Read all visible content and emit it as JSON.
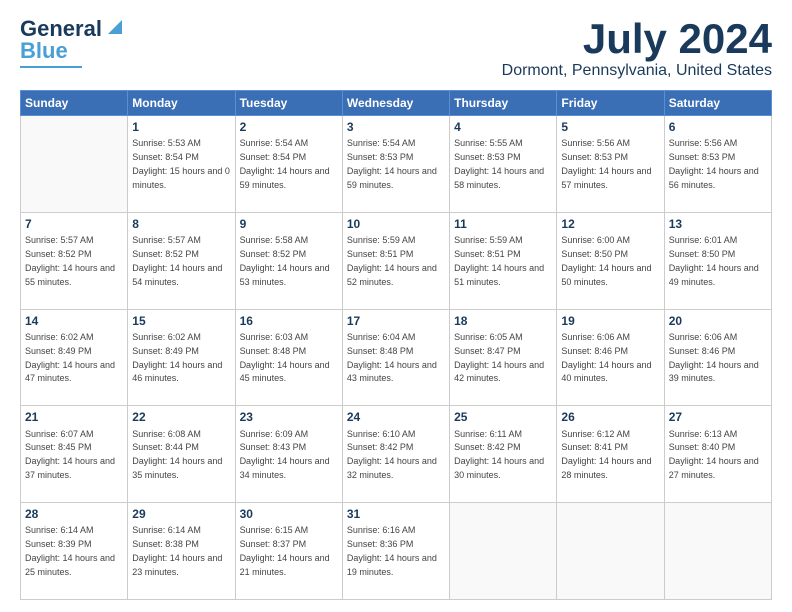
{
  "header": {
    "logo_line1": "General",
    "logo_line2": "Blue",
    "month": "July 2024",
    "location": "Dormont, Pennsylvania, United States"
  },
  "days_of_week": [
    "Sunday",
    "Monday",
    "Tuesday",
    "Wednesday",
    "Thursday",
    "Friday",
    "Saturday"
  ],
  "weeks": [
    [
      {
        "day": "",
        "sunrise": "",
        "sunset": "",
        "daylight": ""
      },
      {
        "day": "1",
        "sunrise": "Sunrise: 5:53 AM",
        "sunset": "Sunset: 8:54 PM",
        "daylight": "Daylight: 15 hours and 0 minutes."
      },
      {
        "day": "2",
        "sunrise": "Sunrise: 5:54 AM",
        "sunset": "Sunset: 8:54 PM",
        "daylight": "Daylight: 14 hours and 59 minutes."
      },
      {
        "day": "3",
        "sunrise": "Sunrise: 5:54 AM",
        "sunset": "Sunset: 8:53 PM",
        "daylight": "Daylight: 14 hours and 59 minutes."
      },
      {
        "day": "4",
        "sunrise": "Sunrise: 5:55 AM",
        "sunset": "Sunset: 8:53 PM",
        "daylight": "Daylight: 14 hours and 58 minutes."
      },
      {
        "day": "5",
        "sunrise": "Sunrise: 5:56 AM",
        "sunset": "Sunset: 8:53 PM",
        "daylight": "Daylight: 14 hours and 57 minutes."
      },
      {
        "day": "6",
        "sunrise": "Sunrise: 5:56 AM",
        "sunset": "Sunset: 8:53 PM",
        "daylight": "Daylight: 14 hours and 56 minutes."
      }
    ],
    [
      {
        "day": "7",
        "sunrise": "Sunrise: 5:57 AM",
        "sunset": "Sunset: 8:52 PM",
        "daylight": "Daylight: 14 hours and 55 minutes."
      },
      {
        "day": "8",
        "sunrise": "Sunrise: 5:57 AM",
        "sunset": "Sunset: 8:52 PM",
        "daylight": "Daylight: 14 hours and 54 minutes."
      },
      {
        "day": "9",
        "sunrise": "Sunrise: 5:58 AM",
        "sunset": "Sunset: 8:52 PM",
        "daylight": "Daylight: 14 hours and 53 minutes."
      },
      {
        "day": "10",
        "sunrise": "Sunrise: 5:59 AM",
        "sunset": "Sunset: 8:51 PM",
        "daylight": "Daylight: 14 hours and 52 minutes."
      },
      {
        "day": "11",
        "sunrise": "Sunrise: 5:59 AM",
        "sunset": "Sunset: 8:51 PM",
        "daylight": "Daylight: 14 hours and 51 minutes."
      },
      {
        "day": "12",
        "sunrise": "Sunrise: 6:00 AM",
        "sunset": "Sunset: 8:50 PM",
        "daylight": "Daylight: 14 hours and 50 minutes."
      },
      {
        "day": "13",
        "sunrise": "Sunrise: 6:01 AM",
        "sunset": "Sunset: 8:50 PM",
        "daylight": "Daylight: 14 hours and 49 minutes."
      }
    ],
    [
      {
        "day": "14",
        "sunrise": "Sunrise: 6:02 AM",
        "sunset": "Sunset: 8:49 PM",
        "daylight": "Daylight: 14 hours and 47 minutes."
      },
      {
        "day": "15",
        "sunrise": "Sunrise: 6:02 AM",
        "sunset": "Sunset: 8:49 PM",
        "daylight": "Daylight: 14 hours and 46 minutes."
      },
      {
        "day": "16",
        "sunrise": "Sunrise: 6:03 AM",
        "sunset": "Sunset: 8:48 PM",
        "daylight": "Daylight: 14 hours and 45 minutes."
      },
      {
        "day": "17",
        "sunrise": "Sunrise: 6:04 AM",
        "sunset": "Sunset: 8:48 PM",
        "daylight": "Daylight: 14 hours and 43 minutes."
      },
      {
        "day": "18",
        "sunrise": "Sunrise: 6:05 AM",
        "sunset": "Sunset: 8:47 PM",
        "daylight": "Daylight: 14 hours and 42 minutes."
      },
      {
        "day": "19",
        "sunrise": "Sunrise: 6:06 AM",
        "sunset": "Sunset: 8:46 PM",
        "daylight": "Daylight: 14 hours and 40 minutes."
      },
      {
        "day": "20",
        "sunrise": "Sunrise: 6:06 AM",
        "sunset": "Sunset: 8:46 PM",
        "daylight": "Daylight: 14 hours and 39 minutes."
      }
    ],
    [
      {
        "day": "21",
        "sunrise": "Sunrise: 6:07 AM",
        "sunset": "Sunset: 8:45 PM",
        "daylight": "Daylight: 14 hours and 37 minutes."
      },
      {
        "day": "22",
        "sunrise": "Sunrise: 6:08 AM",
        "sunset": "Sunset: 8:44 PM",
        "daylight": "Daylight: 14 hours and 35 minutes."
      },
      {
        "day": "23",
        "sunrise": "Sunrise: 6:09 AM",
        "sunset": "Sunset: 8:43 PM",
        "daylight": "Daylight: 14 hours and 34 minutes."
      },
      {
        "day": "24",
        "sunrise": "Sunrise: 6:10 AM",
        "sunset": "Sunset: 8:42 PM",
        "daylight": "Daylight: 14 hours and 32 minutes."
      },
      {
        "day": "25",
        "sunrise": "Sunrise: 6:11 AM",
        "sunset": "Sunset: 8:42 PM",
        "daylight": "Daylight: 14 hours and 30 minutes."
      },
      {
        "day": "26",
        "sunrise": "Sunrise: 6:12 AM",
        "sunset": "Sunset: 8:41 PM",
        "daylight": "Daylight: 14 hours and 28 minutes."
      },
      {
        "day": "27",
        "sunrise": "Sunrise: 6:13 AM",
        "sunset": "Sunset: 8:40 PM",
        "daylight": "Daylight: 14 hours and 27 minutes."
      }
    ],
    [
      {
        "day": "28",
        "sunrise": "Sunrise: 6:14 AM",
        "sunset": "Sunset: 8:39 PM",
        "daylight": "Daylight: 14 hours and 25 minutes."
      },
      {
        "day": "29",
        "sunrise": "Sunrise: 6:14 AM",
        "sunset": "Sunset: 8:38 PM",
        "daylight": "Daylight: 14 hours and 23 minutes."
      },
      {
        "day": "30",
        "sunrise": "Sunrise: 6:15 AM",
        "sunset": "Sunset: 8:37 PM",
        "daylight": "Daylight: 14 hours and 21 minutes."
      },
      {
        "day": "31",
        "sunrise": "Sunrise: 6:16 AM",
        "sunset": "Sunset: 8:36 PM",
        "daylight": "Daylight: 14 hours and 19 minutes."
      },
      {
        "day": "",
        "sunrise": "",
        "sunset": "",
        "daylight": ""
      },
      {
        "day": "",
        "sunrise": "",
        "sunset": "",
        "daylight": ""
      },
      {
        "day": "",
        "sunrise": "",
        "sunset": "",
        "daylight": ""
      }
    ]
  ]
}
